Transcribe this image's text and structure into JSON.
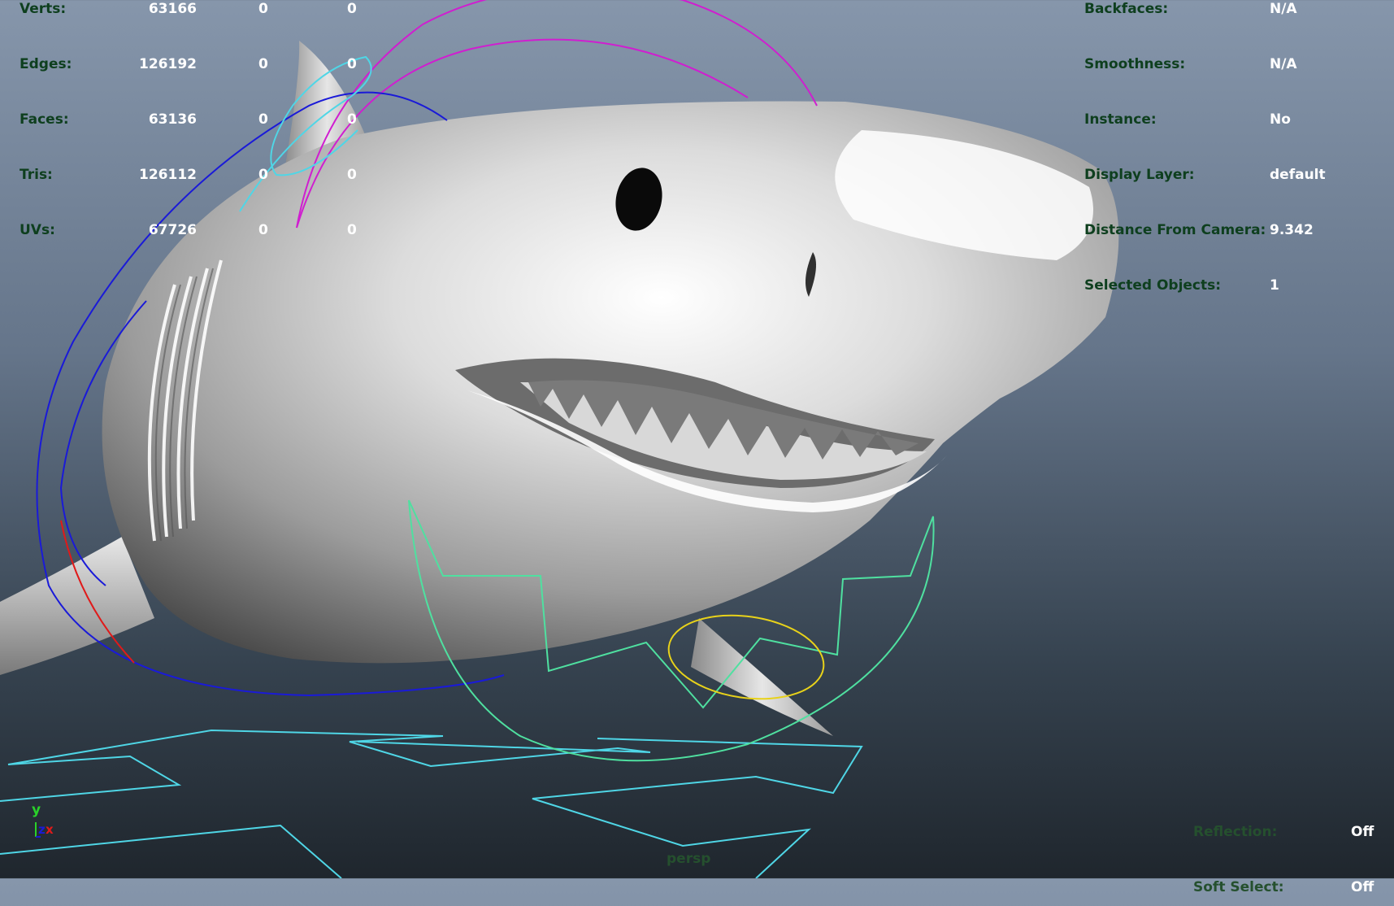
{
  "poly_stats": {
    "rows": [
      {
        "label": "Verts:",
        "value": "63166",
        "col2": "0",
        "col3": "0"
      },
      {
        "label": "Edges:",
        "value": "126192",
        "col2": "0",
        "col3": "0"
      },
      {
        "label": "Faces:",
        "value": "63136",
        "col2": "0",
        "col3": "0"
      },
      {
        "label": "Tris:",
        "value": "126112",
        "col2": "0",
        "col3": "0"
      },
      {
        "label": "UVs:",
        "value": "67726",
        "col2": "0",
        "col3": "0"
      }
    ]
  },
  "object_info": {
    "rows": [
      {
        "label": "Backfaces:",
        "value": "N/A"
      },
      {
        "label": "Smoothness:",
        "value": "N/A"
      },
      {
        "label": "Instance:",
        "value": "No"
      },
      {
        "label": "Display Layer:",
        "value": "default"
      },
      {
        "label": "Distance From Camera:",
        "value": "9.342"
      },
      {
        "label": "Selected Objects:",
        "value": "1"
      }
    ]
  },
  "viewport_flags": {
    "rows": [
      {
        "label": "Reflection:",
        "value": "Off"
      },
      {
        "label": "Soft Select:",
        "value": "Off"
      }
    ]
  },
  "camera": {
    "name": "persp"
  },
  "axis_gizmo": {
    "y": "y",
    "z": "z",
    "x": "x"
  },
  "colors": {
    "hud_label": "#0e3f1e",
    "hud_value": "#ffffff",
    "control_magenta": "#d01ed0",
    "control_blue": "#1a1ad8",
    "control_cyan": "#4fd6e6",
    "control_green": "#4fe0a0",
    "control_yellow": "#e8d21a",
    "control_red": "#e01a1a"
  }
}
